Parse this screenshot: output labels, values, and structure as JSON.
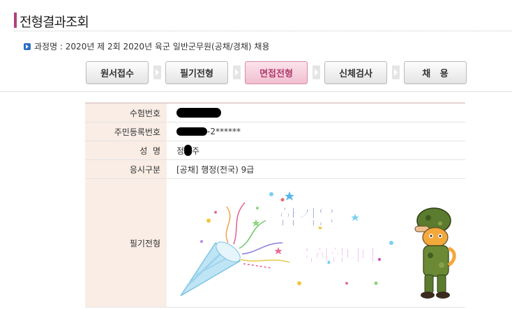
{
  "page": {
    "title": "전형결과조회"
  },
  "course": {
    "text": "과정명 : 2020년 제 2회 2020년 육군 일반군무원(공채/경채) 채용"
  },
  "steps": [
    {
      "label": "원서접수",
      "active": false
    },
    {
      "label": "필기전형",
      "active": false
    },
    {
      "label": "면접전형",
      "active": true
    },
    {
      "label": "신체검사",
      "active": false
    },
    {
      "label": "채   용",
      "active": false
    }
  ],
  "info": {
    "exam_no_label": "수험번호",
    "exam_no_value": "",
    "resident_no_label": "주민등록번호",
    "resident_no_value": "-2******",
    "name_label": "성  명",
    "name_first": "정",
    "name_last": "주",
    "category_label": "응시구분",
    "category_value": "[공채] 행정(전국) 9급",
    "written_label": "필기전형"
  },
  "congrats": {
    "line1": "합격을",
    "line2": "축하합니다."
  }
}
